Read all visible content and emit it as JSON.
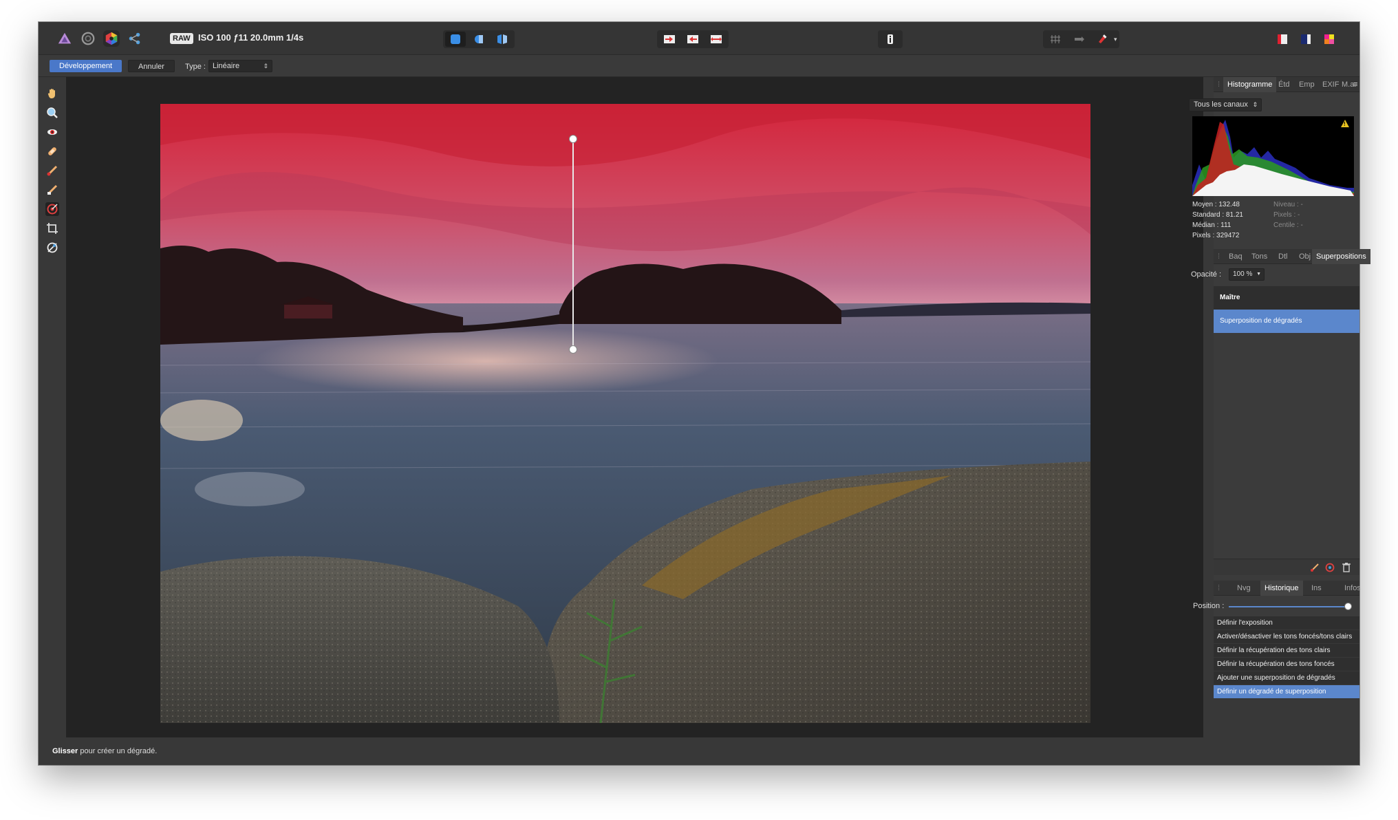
{
  "toolbar": {
    "raw_badge": "RAW",
    "exif": "ISO 100 ƒ11 20.0mm 1/4s"
  },
  "context": {
    "develop_label": "Développement",
    "cancel_label": "Annuler",
    "type_label": "Type :",
    "type_value": "Linéaire",
    "type_arrows": "⌃⌄"
  },
  "histogram_panel": {
    "tabs": [
      "Histogramme",
      "Étd",
      "Emp",
      "EXIF",
      "M.a."
    ],
    "menu_glyph": "≡",
    "channel_value": "Tous les canaux",
    "stats": {
      "mean": "Moyen : 132.48",
      "std": "Standard : 81.21",
      "median": "Médian : 111",
      "pixels": "Pixels : 329472",
      "level": "Niveau : -",
      "pixels_sel": "Pixels : -",
      "centile": "Centile : -"
    }
  },
  "adjust_panel": {
    "tabs": [
      "Baq",
      "Tons",
      "Dtl",
      "Obj",
      "Superpositions"
    ],
    "opacity_label": "Opacité :",
    "opacity_value": "100 %",
    "master": "Maître",
    "overlay": "Superposition de dégradés"
  },
  "history_panel": {
    "tabs": [
      "Nvg",
      "Historique",
      "Ins",
      "Infos"
    ],
    "position_label": "Position :",
    "position_fraction": 1.0,
    "items": [
      "Définir l'exposition",
      "Activer/désactiver les tons foncés/tons clairs",
      "Définir la récupération des tons clairs",
      "Définir la récupération des tons foncés",
      "Ajouter une superposition de dégradés",
      "Définir un dégradé de superposition"
    ],
    "active_index": 5
  },
  "status": {
    "bold": "Glisser",
    "rest": " pour créer un dégradé."
  },
  "colors": {
    "accent": "#4a78c9",
    "selection": "#5b87cc",
    "sky_top": "#d8323f"
  }
}
